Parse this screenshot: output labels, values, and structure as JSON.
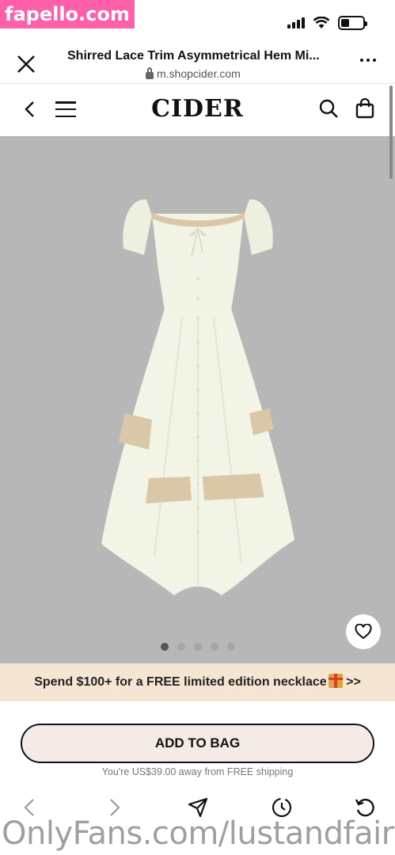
{
  "watermarks": {
    "top": "fapello.com",
    "bottom": "OnlyFans.com/lustandfairy"
  },
  "browser": {
    "title": "Shirred Lace Trim Asymmetrical Hem Mi...",
    "url": "m.shopcider.com"
  },
  "site": {
    "logo": "CIDER"
  },
  "product": {
    "image_count": 5,
    "active_image": 1
  },
  "promo": {
    "text": "Spend $100+ for a FREE limited edition necklace",
    "suffix": " >>"
  },
  "cta": {
    "add_to_bag": "ADD TO BAG",
    "shipping_note": "You're US$39.00 away from FREE shipping"
  },
  "icons": [
    "close-icon",
    "lock-icon",
    "more-icon",
    "back-icon",
    "menu-icon",
    "search-icon",
    "bag-icon",
    "heart-icon",
    "gift-icon",
    "nav-back-icon",
    "nav-forward-icon",
    "share-icon",
    "history-icon",
    "reload-icon"
  ],
  "colors": {
    "promo_bg": "#f5e6d3",
    "cta_bg": "#f5ebe6",
    "image_bg": "#b7b7b7",
    "watermark_pink": "#ff5fa8"
  }
}
